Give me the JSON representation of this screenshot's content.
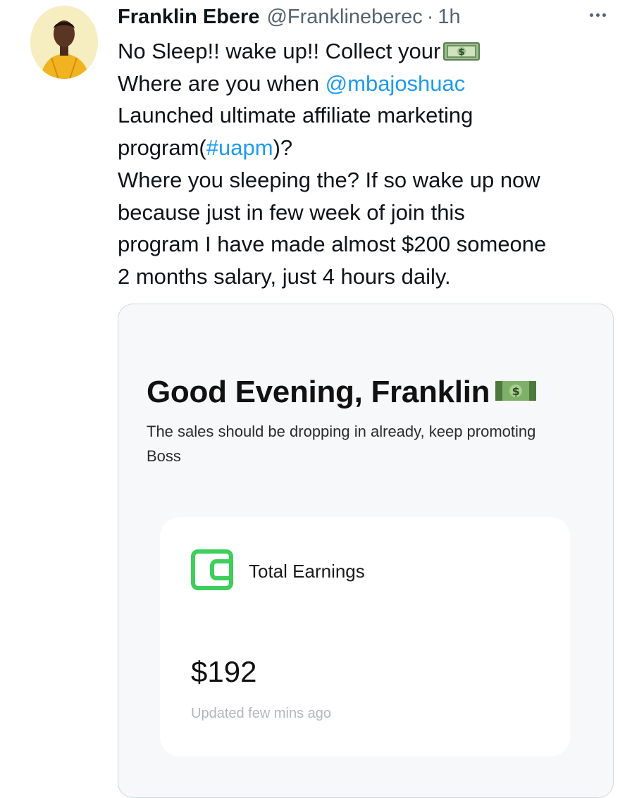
{
  "tweet": {
    "author_name": "Franklin Ebere",
    "handle": "@Franklineberec",
    "separator": "·",
    "time": "1h",
    "more_icon": "more-dots-icon",
    "lines": {
      "l1_pre": "No Sleep!! wake up!! Collect your",
      "l2_pre": "Where are you when ",
      "l2_mention": "@mbajoshuac",
      "l3": "Launched ultimate affiliate marketing",
      "l4_pre": "program(",
      "l4_hashtag": "#uapm",
      "l4_post": ")?",
      "l5": "Where you sleeping the? If so wake up now",
      "l6": "because just in few week of join this",
      "l7": "program I have made almost $200 someone",
      "l8": "2 months salary, just 4 hours daily."
    },
    "emoji": "money-bill-icon"
  },
  "screenshot": {
    "greeting": "Good Evening, Franklin",
    "greeting_emoji": "money-bill-icon",
    "subtitle": "The sales should be dropping in already, keep promoting Boss",
    "card": {
      "icon": "wallet-icon",
      "label": "Total Earnings",
      "amount": "$192",
      "updated": "Updated few mins ago"
    }
  },
  "colors": {
    "link": "#1d9bf0",
    "secondary_text": "#536471",
    "wallet_green": "#3ccf5a"
  }
}
